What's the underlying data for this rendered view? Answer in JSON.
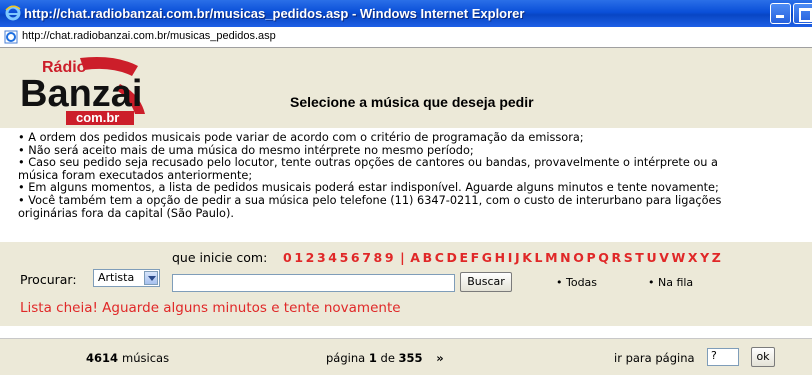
{
  "window": {
    "title": "http://chat.radiobanzai.com.br/musicas_pedidos.asp - Windows Internet Explorer"
  },
  "address": {
    "url": "http://chat.radiobanzai.com.br/musicas_pedidos.asp"
  },
  "logo": {
    "line1": "Rádio",
    "line2": "Banzai",
    "line3": "com.br"
  },
  "header": {
    "title": "Selecione a música que deseja pedir"
  },
  "rules": [
    "• A ordem dos pedidos musicais pode variar de acordo com o critério de programação da emissora;",
    "• Não será aceito mais de uma música do mesmo intérprete no mesmo período;",
    "• Caso seu pedido seja recusado pelo locutor, tente outras opções de cantores ou bandas, provavelmente o intérprete ou a",
    "música foram executados anteriormente;",
    "• Em alguns momentos, a lista de pedidos musicais poderá estar indisponível. Aguarde alguns minutos e tente novamente;",
    "• Você também tem a opção de pedir a sua música pelo telefone (11) 6347-0211, com o custo de interurbano para ligações",
    "originárias fora da capital (São Paulo)."
  ],
  "search": {
    "procurar_label": "Procurar:",
    "select_value": "Artista",
    "start_label": "que inicie com:",
    "digits": [
      "0",
      "1",
      "2",
      "3",
      "4",
      "5",
      "6",
      "7",
      "8",
      "9"
    ],
    "separator": "|",
    "letters": [
      "A",
      "B",
      "C",
      "D",
      "E",
      "F",
      "G",
      "H",
      "I",
      "J",
      "K",
      "L",
      "M",
      "N",
      "O",
      "P",
      "Q",
      "R",
      "S",
      "T",
      "U",
      "V",
      "W",
      "X",
      "Y",
      "Z"
    ],
    "input_value": "",
    "button": "Buscar",
    "option_all": "• Todas",
    "option_queue": "• Na fila",
    "warning": "Lista cheia! Aguarde alguns minutos e tente novamente"
  },
  "footer": {
    "count": "4614",
    "count_label": "músicas",
    "page_prefix": "página",
    "page_current": "1",
    "page_of": "de",
    "page_total": "355",
    "next": "»",
    "goto_label": "ir para página",
    "goto_value": "?",
    "ok": "ok"
  },
  "colors": {
    "accent": "#e02828",
    "panel": "#ece9d8",
    "title_blue": "#0a4fd8"
  }
}
